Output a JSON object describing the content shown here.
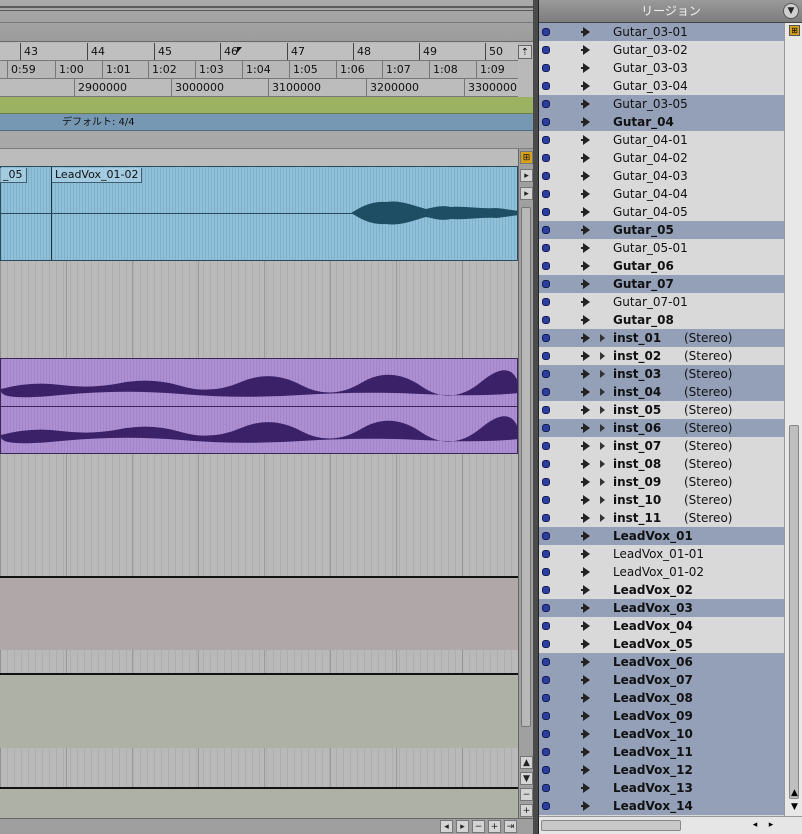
{
  "ruler": {
    "bars": [
      "43",
      "44",
      "45",
      "46",
      "47",
      "48",
      "49",
      "50"
    ],
    "minutes": [
      "0:59",
      "1:00",
      "1:01",
      "1:02",
      "1:03",
      "1:04",
      "1:05",
      "1:06",
      "1:07",
      "1:08",
      "1:09"
    ],
    "samples": [
      "2900000",
      "3000000",
      "3100000",
      "3200000",
      "3300000"
    ]
  },
  "meter": {
    "label": "デフォルト: 4/4"
  },
  "edit_regions": {
    "region_prev": "_05",
    "region_leadvox": "LeadVox_01-02"
  },
  "region_list": {
    "title": "リージョン",
    "items": [
      {
        "name": "Gutar_03-01",
        "bold": false,
        "sel": true,
        "stereo": false
      },
      {
        "name": "Gutar_03-02",
        "bold": false,
        "sel": false,
        "stereo": false
      },
      {
        "name": "Gutar_03-03",
        "bold": false,
        "sel": false,
        "stereo": false
      },
      {
        "name": "Gutar_03-04",
        "bold": false,
        "sel": false,
        "stereo": false
      },
      {
        "name": "Gutar_03-05",
        "bold": false,
        "sel": true,
        "stereo": false
      },
      {
        "name": "Gutar_04",
        "bold": true,
        "sel": true,
        "stereo": false
      },
      {
        "name": "Gutar_04-01",
        "bold": false,
        "sel": false,
        "stereo": false
      },
      {
        "name": "Gutar_04-02",
        "bold": false,
        "sel": false,
        "stereo": false
      },
      {
        "name": "Gutar_04-03",
        "bold": false,
        "sel": false,
        "stereo": false
      },
      {
        "name": "Gutar_04-04",
        "bold": false,
        "sel": false,
        "stereo": false
      },
      {
        "name": "Gutar_04-05",
        "bold": false,
        "sel": false,
        "stereo": false
      },
      {
        "name": "Gutar_05",
        "bold": true,
        "sel": true,
        "stereo": false
      },
      {
        "name": "Gutar_05-01",
        "bold": false,
        "sel": false,
        "stereo": false
      },
      {
        "name": "Gutar_06",
        "bold": true,
        "sel": false,
        "stereo": false
      },
      {
        "name": "Gutar_07",
        "bold": true,
        "sel": true,
        "stereo": false
      },
      {
        "name": "Gutar_07-01",
        "bold": false,
        "sel": false,
        "stereo": false
      },
      {
        "name": "Gutar_08",
        "bold": true,
        "sel": false,
        "stereo": false
      },
      {
        "name": "inst_01",
        "bold": true,
        "sel": true,
        "stereo": true
      },
      {
        "name": "inst_02",
        "bold": true,
        "sel": false,
        "stereo": true
      },
      {
        "name": "inst_03",
        "bold": true,
        "sel": true,
        "stereo": true
      },
      {
        "name": "inst_04",
        "bold": true,
        "sel": true,
        "stereo": true
      },
      {
        "name": "inst_05",
        "bold": true,
        "sel": false,
        "stereo": true
      },
      {
        "name": "inst_06",
        "bold": true,
        "sel": true,
        "stereo": true
      },
      {
        "name": "inst_07",
        "bold": true,
        "sel": false,
        "stereo": true
      },
      {
        "name": "inst_08",
        "bold": true,
        "sel": false,
        "stereo": true
      },
      {
        "name": "inst_09",
        "bold": true,
        "sel": false,
        "stereo": true
      },
      {
        "name": "inst_10",
        "bold": true,
        "sel": false,
        "stereo": true
      },
      {
        "name": "inst_11",
        "bold": true,
        "sel": false,
        "stereo": true
      },
      {
        "name": "LeadVox_01",
        "bold": true,
        "sel": true,
        "stereo": false
      },
      {
        "name": "LeadVox_01-01",
        "bold": false,
        "sel": false,
        "stereo": false
      },
      {
        "name": "LeadVox_01-02",
        "bold": false,
        "sel": false,
        "stereo": false
      },
      {
        "name": "LeadVox_02",
        "bold": true,
        "sel": false,
        "stereo": false
      },
      {
        "name": "LeadVox_03",
        "bold": true,
        "sel": true,
        "stereo": false
      },
      {
        "name": "LeadVox_04",
        "bold": true,
        "sel": false,
        "stereo": false
      },
      {
        "name": "LeadVox_05",
        "bold": true,
        "sel": false,
        "stereo": false
      },
      {
        "name": "LeadVox_06",
        "bold": true,
        "sel": true,
        "stereo": false
      },
      {
        "name": "LeadVox_07",
        "bold": true,
        "sel": true,
        "stereo": false
      },
      {
        "name": "LeadVox_08",
        "bold": true,
        "sel": true,
        "stereo": false
      },
      {
        "name": "LeadVox_09",
        "bold": true,
        "sel": true,
        "stereo": false
      },
      {
        "name": "LeadVox_10",
        "bold": true,
        "sel": true,
        "stereo": false
      },
      {
        "name": "LeadVox_11",
        "bold": true,
        "sel": true,
        "stereo": false
      },
      {
        "name": "LeadVox_12",
        "bold": true,
        "sel": true,
        "stereo": false
      },
      {
        "name": "LeadVox_13",
        "bold": true,
        "sel": true,
        "stereo": false
      },
      {
        "name": "LeadVox_14",
        "bold": true,
        "sel": true,
        "stereo": false
      }
    ],
    "stereo_suffix": "(Stereo)"
  },
  "colors": {
    "audio_region": "#8fc1da",
    "stereo_region": "#ad8fd3",
    "selection": "#93a0b8",
    "marker_ruler": "#9bb262",
    "meter_ruler": "#7698b3"
  },
  "icons": [
    "region-triangle-icon",
    "disclosure-triangle-icon",
    "region-dot-icon",
    "menu-popup-icon",
    "scroll-arrow-icon",
    "zoom-icon"
  ]
}
